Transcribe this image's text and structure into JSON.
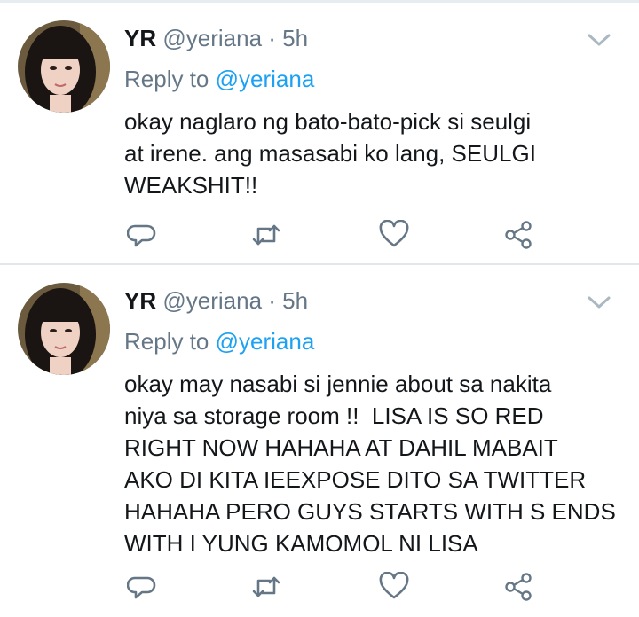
{
  "colors": {
    "text": "#14171a",
    "muted": "#657786",
    "link": "#1da1f2",
    "divider": "#e1e8ed"
  },
  "tweets": [
    {
      "name": "YR",
      "handle": "@yeriana",
      "separator": "·",
      "time": "5h",
      "reply_label": "Reply to",
      "reply_mention": "@yeriana",
      "text": "okay naglaro ng bato-bato-pick si seulgi\nat irene. ang masasabi ko lang, SEULGI\nWEAKSHIT!!",
      "icons": [
        "reply-icon",
        "retweet-icon",
        "like-icon",
        "share-icon",
        "chevron-down-icon"
      ]
    },
    {
      "name": "YR",
      "handle": "@yeriana",
      "separator": "·",
      "time": "5h",
      "reply_label": "Reply to",
      "reply_mention": "@yeriana",
      "text": "okay may nasabi si jennie about sa nakita\nniya sa storage room !!  LISA IS SO RED\nRIGHT NOW HAHAHA AT DAHIL MABAIT\nAKO DI KITA IEEXPOSE DITO SA TWITTER\nHAHAHA PERO GUYS STARTS WITH S ENDS\nWITH I YUNG KAMOMOL NI LISA",
      "icons": [
        "reply-icon",
        "retweet-icon",
        "like-icon",
        "share-icon",
        "chevron-down-icon"
      ]
    }
  ]
}
